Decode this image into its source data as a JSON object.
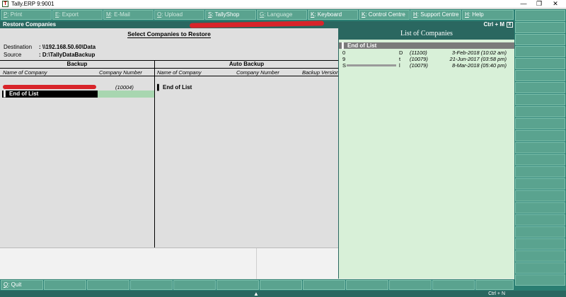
{
  "window": {
    "title": "Tally.ERP 9:9001",
    "minimize": "—",
    "restore": "❐",
    "close": "✕"
  },
  "menu": [
    {
      "key": "P",
      "label": ": Print",
      "enabled": false
    },
    {
      "key": "E",
      "label": ": Export",
      "enabled": false
    },
    {
      "key": "M",
      "label": ": E-Mail",
      "enabled": false
    },
    {
      "key": "O",
      "label": ": Upload",
      "enabled": false
    },
    {
      "key": "S",
      "label": ": TallyShop",
      "enabled": true
    },
    {
      "key": "G",
      "label": ": Language",
      "enabled": false
    },
    {
      "key": "K",
      "label": ": Keyboard",
      "enabled": true
    },
    {
      "key": "K",
      "label": ": Control Centre",
      "enabled": true
    },
    {
      "key": "H",
      "label": ": Support Centre",
      "enabled": true
    },
    {
      "key": "H",
      "label": ": Help",
      "enabled": true
    }
  ],
  "header": {
    "title": "Restore Companies",
    "shortcut": "Ctrl + M",
    "close": "x"
  },
  "main": {
    "caption": "Select Companies to Restore",
    "destination_label": "Destination",
    "destination_value": ": \\\\192.168.50.60\\Data",
    "source_label": "Source",
    "source_value": ": D:\\TallyDataBackup",
    "backup_title": "Backup",
    "autobackup_title": "Auto Backup",
    "backup_col_name": "Name of Company",
    "backup_col_number": "Company Number",
    "auto_col_name": "Name of Company",
    "auto_col_number": "Company Number",
    "auto_col_version": "Backup Version",
    "backup_row_number": "(10004)",
    "end_of_list": "End of List",
    "marker": "▌"
  },
  "list": {
    "title": "List of Companies",
    "end_of_list": "End of List",
    "rows": [
      {
        "c0": "0",
        "c1": "D",
        "c2": "(11100)",
        "c3": "3-Feb-2018 (10:02 am)"
      },
      {
        "c0": "9",
        "c1": "t",
        "c2": "(10079)",
        "c3": "21-Jun-2017 (03:58 pm)"
      },
      {
        "c0": "S",
        "c1": "l",
        "c2": "(10079)",
        "c3": "8-Mar-2018 (05:40 pm)"
      }
    ]
  },
  "bottombar": {
    "quit_key": "Q",
    "quit_label": ": Quit"
  },
  "statusbar": {
    "chevron": "▲",
    "shortcut": "Ctrl + N"
  },
  "colors": {
    "menu_bg": "#2a7e72",
    "button_bg": "#5aa38f",
    "header_bg": "#2a6760",
    "list_bg": "#d8f0d8",
    "redaction": "#d8242a"
  }
}
